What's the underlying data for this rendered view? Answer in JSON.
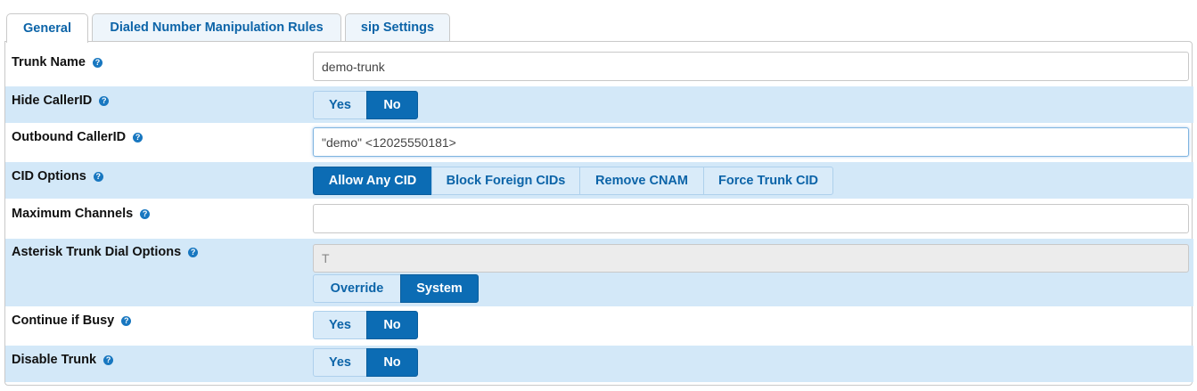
{
  "tabs": [
    {
      "label": "General",
      "active": true
    },
    {
      "label": "Dialed Number Manipulation Rules",
      "active": false
    },
    {
      "label": "sip Settings",
      "active": false
    }
  ],
  "help_glyph": "?",
  "fields": {
    "trunk_name": {
      "label": "Trunk Name",
      "value": "demo-trunk"
    },
    "hide_callerid": {
      "label": "Hide CallerID",
      "options": [
        "Yes",
        "No"
      ],
      "selected": "No"
    },
    "outbound_callerid": {
      "label": "Outbound CallerID",
      "value": "\"demo\" <12025550181>"
    },
    "cid_options": {
      "label": "CID Options",
      "options": [
        "Allow Any CID",
        "Block Foreign CIDs",
        "Remove CNAM",
        "Force Trunk CID"
      ],
      "selected": "Allow Any CID"
    },
    "max_channels": {
      "label": "Maximum Channels",
      "value": ""
    },
    "dial_options": {
      "label": "Asterisk Trunk Dial Options",
      "value": "T",
      "options": [
        "Override",
        "System"
      ],
      "selected": "System"
    },
    "continue_busy": {
      "label": "Continue if Busy",
      "options": [
        "Yes",
        "No"
      ],
      "selected": "No"
    },
    "disable_trunk": {
      "label": "Disable Trunk",
      "options": [
        "Yes",
        "No"
      ],
      "selected": "No"
    }
  },
  "colors": {
    "accent": "#0c6cb4",
    "row_alt": "#d3e8f8",
    "segment_bg": "#d9ebf9"
  }
}
